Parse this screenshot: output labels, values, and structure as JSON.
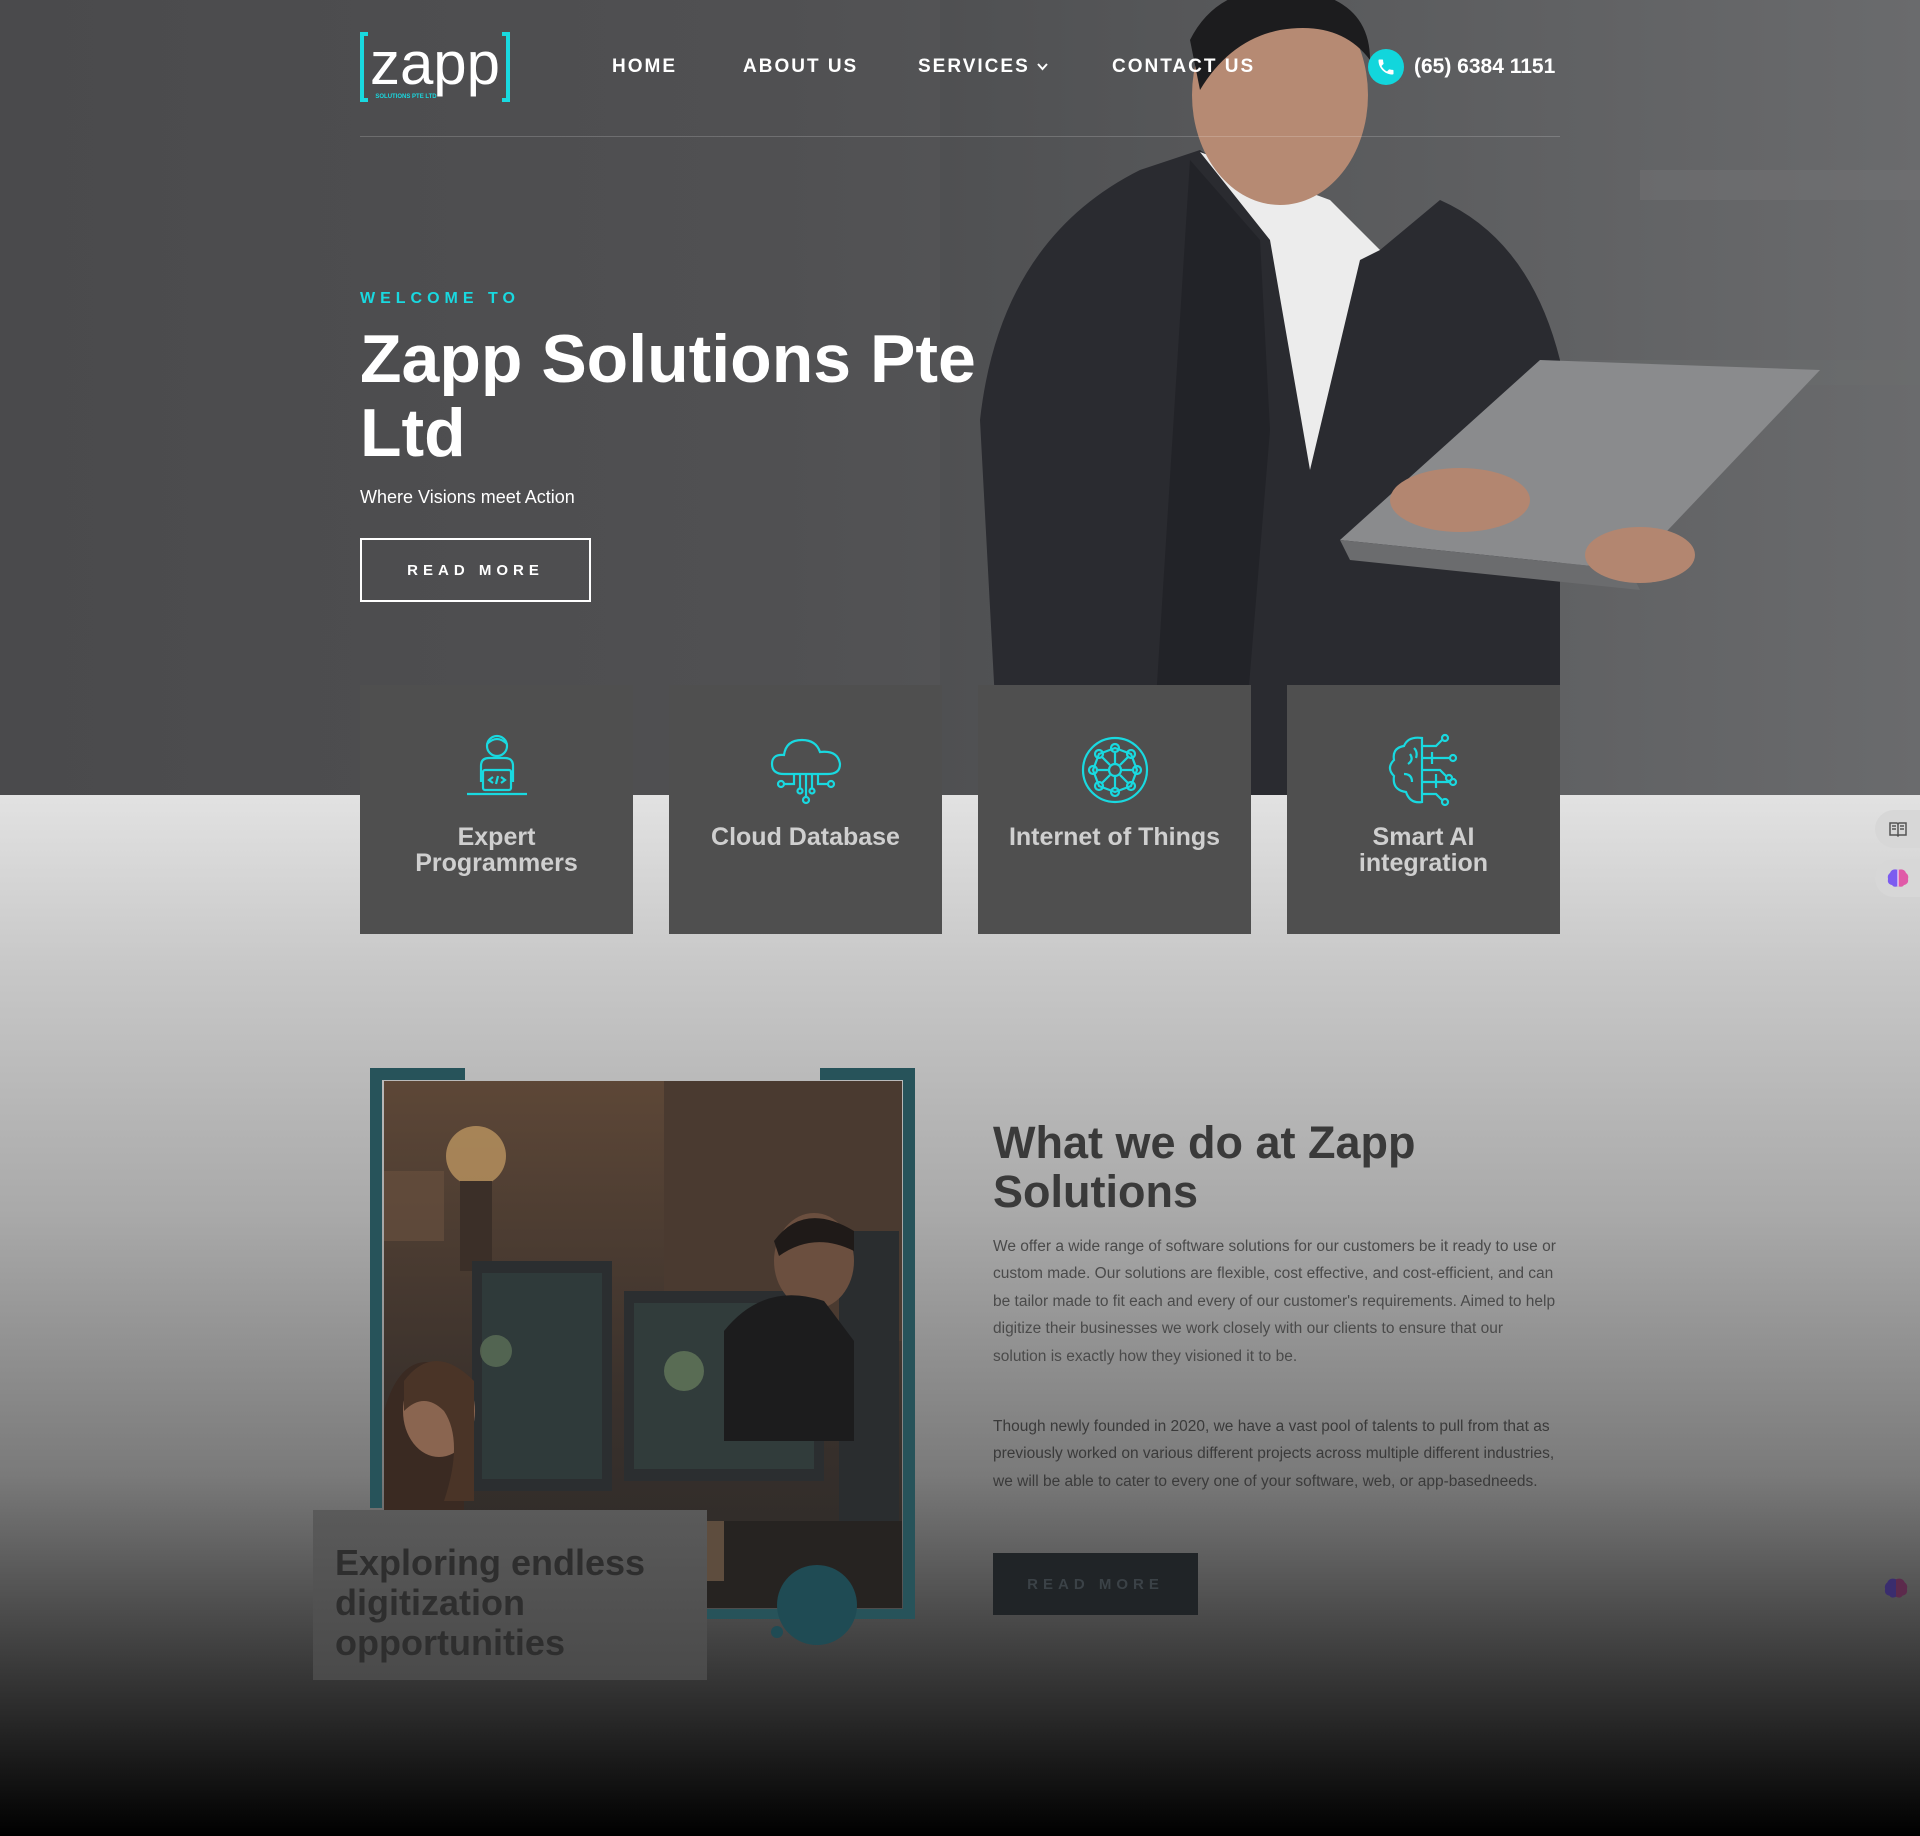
{
  "header": {
    "logo_text": "zapp",
    "logo_subtext": "SOLUTIONS PTE LTD",
    "nav": [
      {
        "label": "HOME"
      },
      {
        "label": "ABOUT US"
      },
      {
        "label": "SERVICES"
      },
      {
        "label": "CONTACT US"
      }
    ],
    "phone": "(65) 6384 1151"
  },
  "hero": {
    "welcome": "WELCOME TO",
    "title": "Zapp Solutions Pte Ltd",
    "tagline": "Where Visions meet Action",
    "button": "READ MORE"
  },
  "services": [
    {
      "label": "Expert Programmers",
      "icon": "programmer-icon"
    },
    {
      "label": "Cloud Database",
      "icon": "cloud-database-icon"
    },
    {
      "label": "Internet of Things",
      "icon": "iot-globe-icon"
    },
    {
      "label": "Smart AI integration",
      "icon": "ai-brain-icon"
    }
  ],
  "about": {
    "caption": "Exploring endless digitization opportunities",
    "title": "What we do at Zapp Solutions",
    "paragraph1": "We offer a wide range of software solutions for our customers be it ready to use or custom made. Our solutions are flexible, cost effective, and cost-efficient, and can be tailor made to fit each and every of our customer's requirements. Aimed to help digitize their businesses we work closely with our clients to ensure that our solution is exactly how they visioned it to be.",
    "paragraph2": "Though newly founded in 2020, we have a vast pool of talents to pull from that as previously worked on various different projects across multiple different industries, we will be able to cater to every one of your software, web, or app-basedneeds.",
    "button": "READ MORE"
  },
  "colors": {
    "accent": "#19d9e0",
    "card_bg": "#4f4f4f",
    "hero_bg": "#505052"
  }
}
